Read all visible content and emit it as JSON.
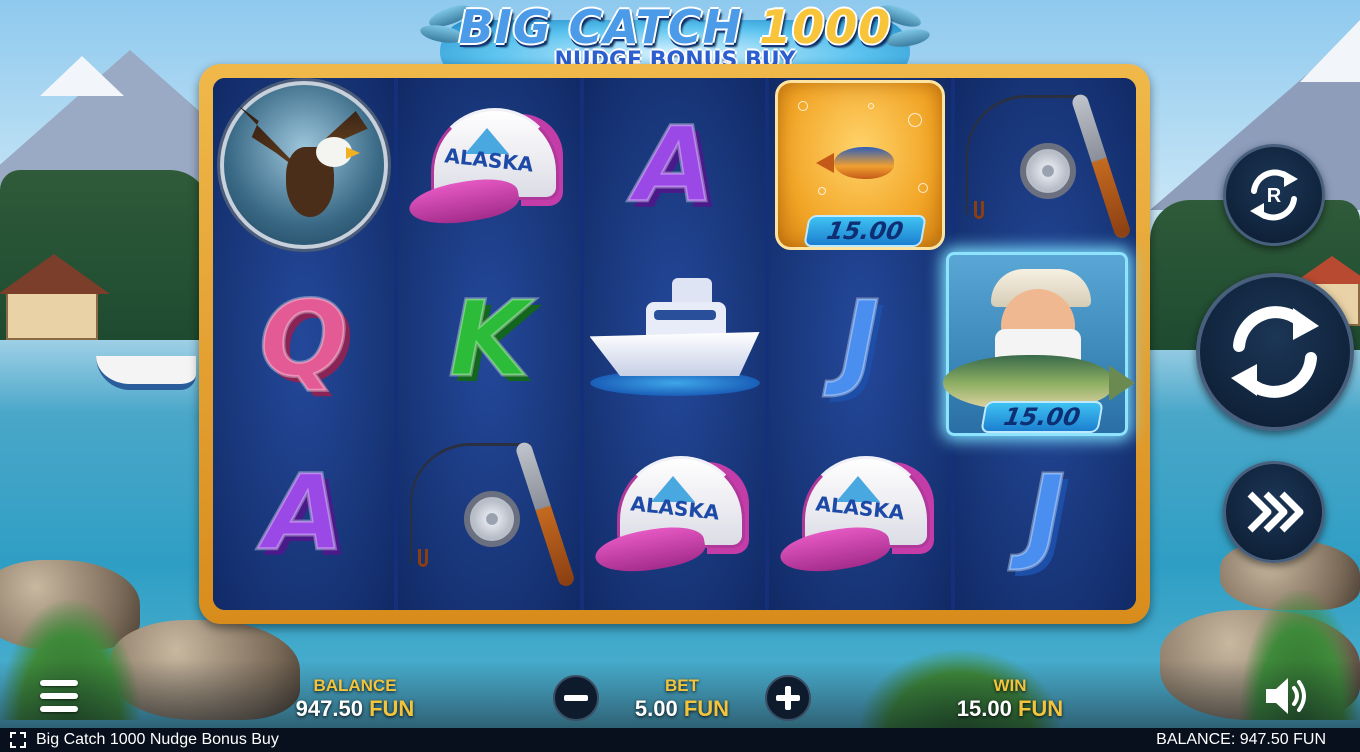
{
  "game": {
    "title_main": "BIG CATCH",
    "title_number": "1000",
    "subtitle": "NUDGE BONUS BUY"
  },
  "reels": [
    [
      "eagle",
      "Q",
      "A"
    ],
    [
      "alaska-cap",
      "K",
      "fishing-rod"
    ],
    [
      "A",
      "yacht",
      "alaska-cap"
    ],
    [
      "money-fish",
      "J",
      "alaska-cap"
    ],
    [
      "fishing-rod",
      "fisherman",
      "J"
    ]
  ],
  "symbols": {
    "cap_text": "ALASKA",
    "money_fish_value": "15.00",
    "fisherman_value": "15.00"
  },
  "controls": {
    "autoplay_letter": "R",
    "autoplay_icon": "autoplay-icon",
    "spin_icon": "spin-icon",
    "turbo_icon": "fast-forward-icon"
  },
  "bottom_bar": {
    "balance_label": "BALANCE",
    "balance_value": "947.50",
    "bet_label": "BET",
    "bet_value": "5.00",
    "win_label": "WIN",
    "win_value": "15.00",
    "currency": "FUN"
  },
  "footer": {
    "game_name": "Big Catch 1000 Nudge Bonus Buy",
    "balance_text": "BALANCE: 947.50 FUN"
  },
  "colors": {
    "frame": "#e8a534",
    "reel_bg": "#173476",
    "accent_gold": "#f2c43c",
    "value_tag": "#2fa2e6"
  }
}
